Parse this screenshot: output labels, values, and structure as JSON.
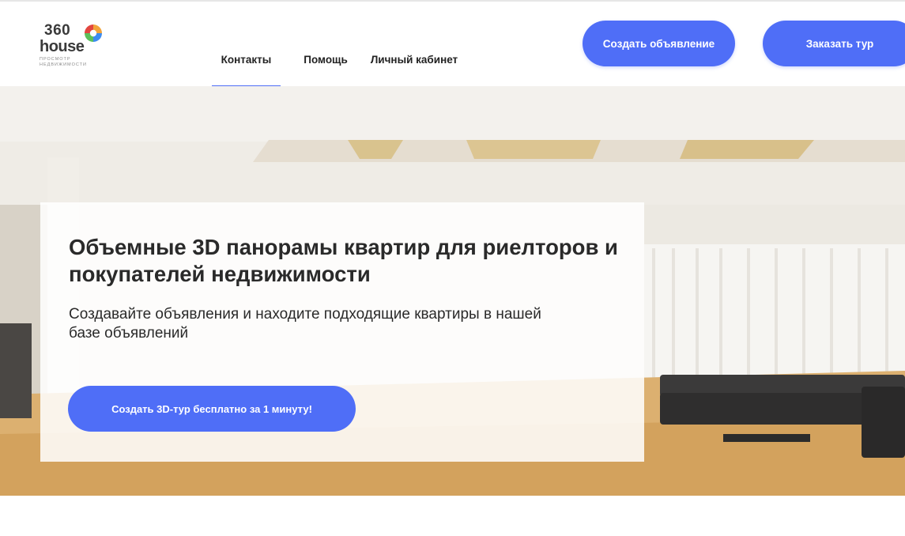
{
  "logo": {
    "number": "360",
    "word": "house",
    "subtitle_line1": "ПРОСМОТР",
    "subtitle_line2": "НЕДВИЖИМОСТИ"
  },
  "nav": {
    "items": [
      {
        "label": "Контакты",
        "active": true
      },
      {
        "label": "Помощь",
        "active": false
      },
      {
        "label": "Личный кабинет",
        "active": false
      }
    ]
  },
  "header_buttons": {
    "create_listing": "Создать объявление",
    "order_tour": "Заказать тур"
  },
  "hero": {
    "title": "Объемные 3D панорамы квартир для риелторов и покупателей недвижимости",
    "text": "Создавайте объявления и находите подходящие квартиры в нашей базе объявлений",
    "cta": "Создать 3D-тур бесплатно за 1 минуту!"
  },
  "colors": {
    "accent": "#4f6ef7",
    "logo_mark": [
      "#f2a33a",
      "#e2463f",
      "#3d8cf0",
      "#5cc05a"
    ]
  }
}
